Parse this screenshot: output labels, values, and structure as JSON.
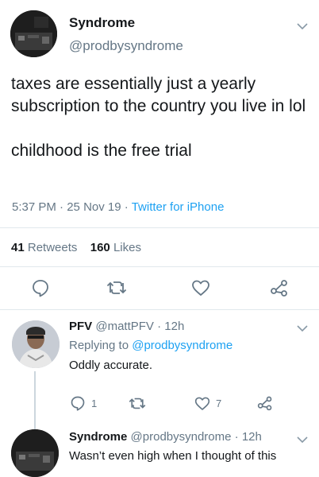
{
  "main_tweet": {
    "display_name": "Syndrome",
    "handle": "@prodbysyndrome",
    "text": "taxes are essentially just a yearly subscription to the country you live in lol\n\nchildhood is the free trial",
    "time": "5:37 PM",
    "date": "25 Nov 19",
    "source": "Twitter for iPhone",
    "separator": "·",
    "retweet_count": "41",
    "retweet_label": "Retweets",
    "like_count": "160",
    "like_label": "Likes",
    "actions": [
      "reply-icon",
      "retweet-icon",
      "like-icon",
      "share-icon"
    ]
  },
  "reply_1": {
    "display_name": "PFV",
    "handle": "@mattPFV",
    "age": "12h",
    "replying_prefix": "Replying to",
    "replying_to": "@prodbysyndrome",
    "text": "Oddly accurate.",
    "reply_count": "1",
    "like_count": "7"
  },
  "reply_2": {
    "display_name": "Syndrome",
    "handle": "@prodbysyndrome",
    "age": "12h",
    "text": "Wasn’t even high when I thought of this"
  },
  "colors": {
    "text": "#14171a",
    "secondary": "#657786",
    "link": "#1da1f2",
    "divider": "#e1e8ed"
  }
}
